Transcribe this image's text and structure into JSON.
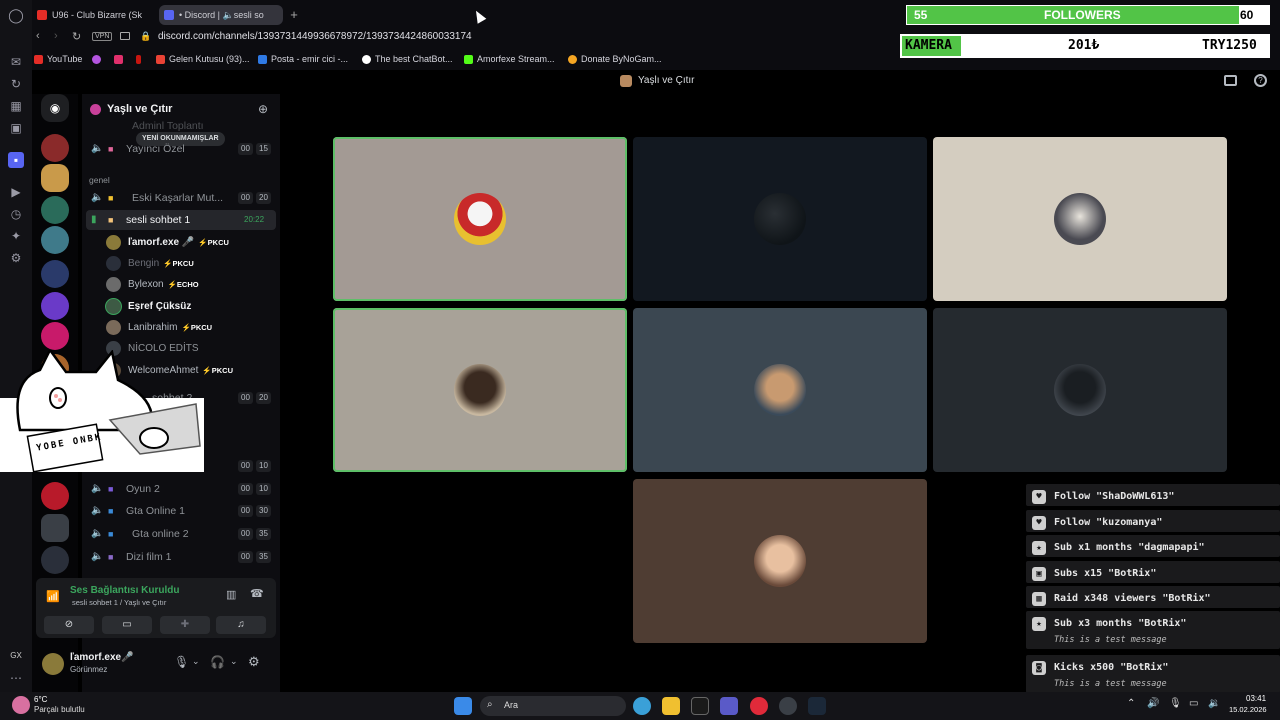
{
  "browser": {
    "tabs": [
      {
        "label": "U96 - Club Bizarre (Sk",
        "favicon_color": "#e52d27"
      },
      {
        "label": "• Discord | 🔈sesli so",
        "favicon_color": "#5865f2"
      }
    ],
    "vpn_label": "VPN",
    "url": "discord.com/channels/1393731449936678972/1393734424860033174",
    "bookmarks": [
      {
        "label": "YouTube",
        "color": "#e52d27"
      },
      {
        "label": "",
        "color": "#b455e0"
      },
      {
        "label": "",
        "color": "#e1306c"
      },
      {
        "label": "",
        "color": "#c71610"
      },
      {
        "label": "Gelen Kutusu (93)...",
        "color": "#ea4335"
      },
      {
        "label": "Posta - emir cici -...",
        "color": "#2f7ae5"
      },
      {
        "label": "The best ChatBot...",
        "color": "#ffffff"
      },
      {
        "label": "Amorfexe Stream...",
        "color": "#53fc18"
      },
      {
        "label": "Donate ByNoGam...",
        "color": "#f5a623"
      }
    ]
  },
  "overlay": {
    "followers_current": "55",
    "followers_label": "FOLLOWERS",
    "followers_goal": "60",
    "followers_progress": 0.917,
    "kamera_label": "KAMERA",
    "kamera_amount": "201₺",
    "kamera_goal": "TRY1250",
    "kamera_progress": 0.16
  },
  "discord": {
    "titlebar_title": "Yaşlı ve Çıtır",
    "server_name": "Yaşlı ve Çıtır",
    "new_unreads": "YENİ OKUNMAMIŞLAR",
    "faded_channel": "Adminl Toplantı",
    "category": "genel",
    "channels": [
      {
        "name": "Yayıncı Özel",
        "badge_a": "00",
        "badge_b": "15"
      },
      {
        "name": "Eski Kaşarlar Mut...",
        "badge_a": "00",
        "badge_b": "20"
      },
      {
        "name": "sesli sohbet 1",
        "badge_b": "20:22"
      },
      {
        "name": "sohbet 2",
        "badge_a": "00",
        "badge_b": "20"
      },
      {
        "name": "",
        "badge_a": "00",
        "badge_b": "10"
      },
      {
        "name": "Oyun 2",
        "badge_a": "00",
        "badge_b": "10"
      },
      {
        "name": "Gta Online 1",
        "badge_a": "00",
        "badge_b": "30"
      },
      {
        "name": "Gta online 2",
        "badge_a": "00",
        "badge_b": "35"
      },
      {
        "name": "Dizi film 1",
        "badge_a": "00",
        "badge_b": "35"
      }
    ],
    "voice_users": [
      {
        "name": "ľamorf.exe 🎤",
        "tag": "PKCU",
        "color": "#f2f3f5",
        "avatar": "#8a7a3a"
      },
      {
        "name": "Bengin",
        "tag": "PKCU",
        "color": "#6d6f78",
        "avatar": "#2a2f3a"
      },
      {
        "name": "Bylexon",
        "tag": "ECHO",
        "color": "#b5bac1",
        "avatar": "#6b6b6b"
      },
      {
        "name": "Eşref Çüksüz",
        "tag": "",
        "color": "#f2f3f5",
        "avatar": "#3d5a44"
      },
      {
        "name": "Lanibrahim",
        "tag": "PKCU",
        "color": "#b5bac1",
        "avatar": "#7a6a5a"
      },
      {
        "name": "NİCOLO EDİTS",
        "tag": "",
        "color": "#8e9297",
        "avatar": "#3a3f46"
      },
      {
        "name": "WelcomeAhmet",
        "tag": "PKCU",
        "color": "#b5bac1",
        "avatar": "#5a4a3a"
      }
    ],
    "voice_status": "Ses Bağlantısı Kuruldu",
    "voice_status_sub": "sesli sohbet 1 / Yaşlı ve Çıtır",
    "self_name": "ľamorf.exe🎤",
    "self_status": "Görünmez"
  },
  "alerts": [
    {
      "title": "Follow \"ShaDoWWL613\"",
      "subtitle": "",
      "icon": "heart-icon"
    },
    {
      "title": "Follow \"kuzomanya\"",
      "subtitle": "",
      "icon": "heart-icon"
    },
    {
      "title": "Sub x1 months \"dagmapapi\"",
      "subtitle": "",
      "icon": "star-icon"
    },
    {
      "title": "Subs x15 \"BotRix\"",
      "subtitle": "",
      "icon": "gift-icon"
    },
    {
      "title": "Raid x348 viewers \"BotRix\"",
      "subtitle": "",
      "icon": "raid-icon"
    },
    {
      "title": "Sub x3 months \"BotRix\"",
      "subtitle": "This is a test message",
      "icon": "star-icon"
    },
    {
      "title": "Kicks x500 \"BotRix\"",
      "subtitle": "This is a test message",
      "icon": "kick-icon"
    }
  ],
  "taskbar": {
    "weather_temp": "6°C",
    "weather_desc": "Parçalı bulutlu",
    "search_placeholder": "Ara",
    "time": "03:41",
    "date": "15.02.2026",
    "gx_label": "GX"
  },
  "overlay_cat_text": "YOBE ONBK"
}
